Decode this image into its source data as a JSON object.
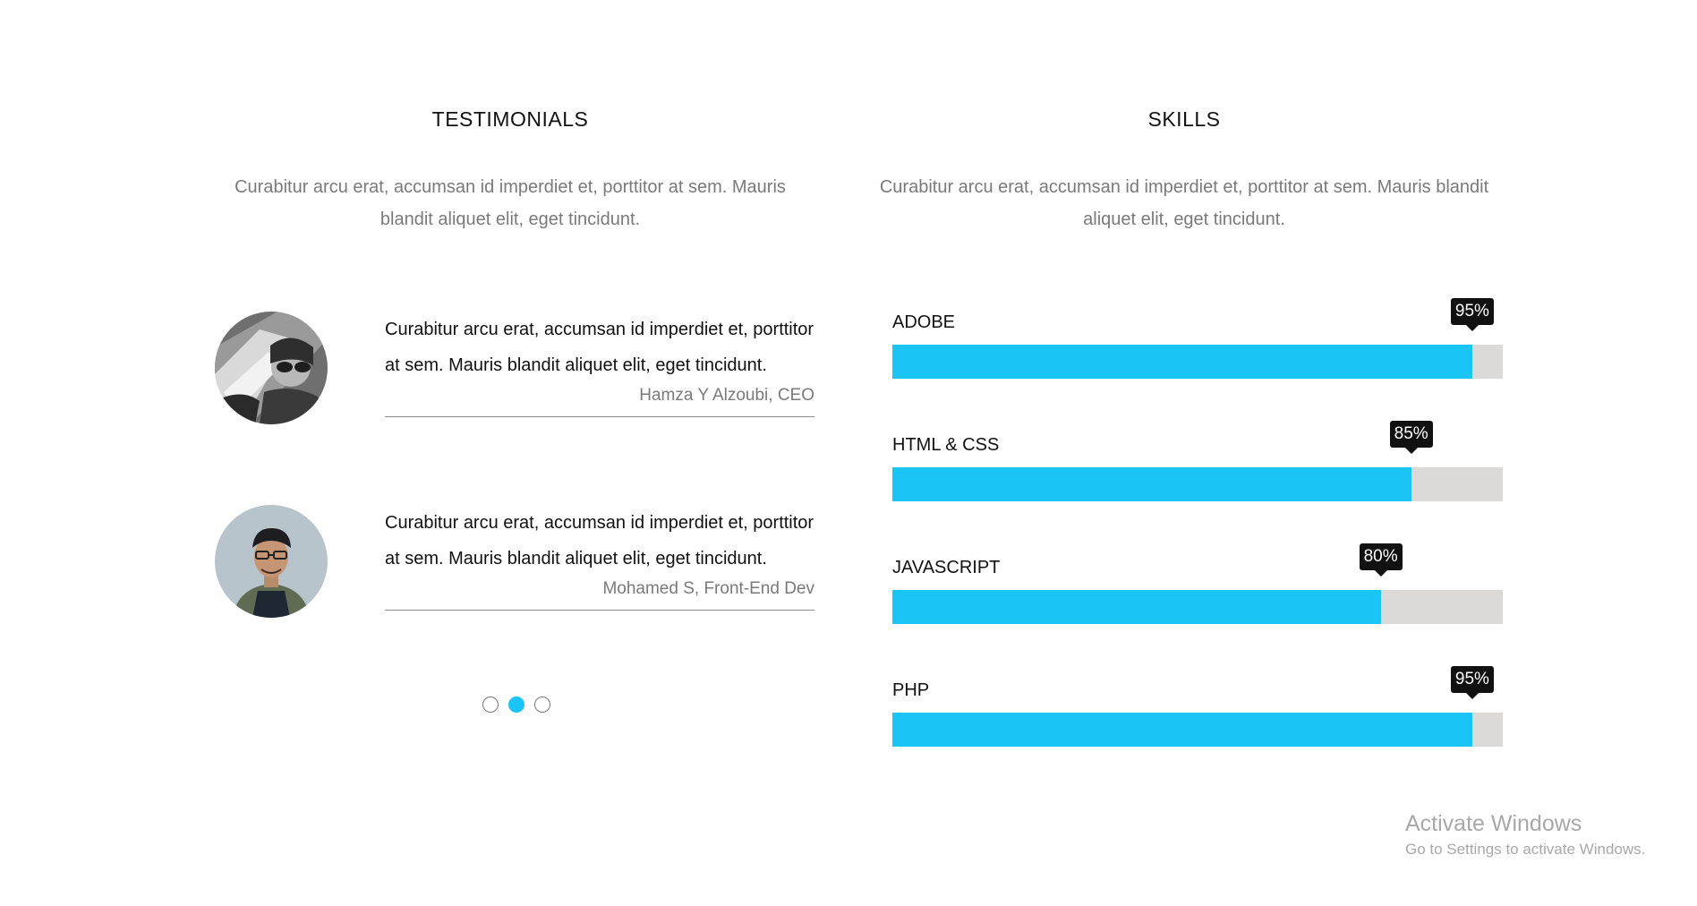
{
  "testimonials": {
    "title": "TESTIMONIALS",
    "intro": "Curabitur arcu erat, accumsan id imperdiet et, porttitor at sem. Mauris blandit aliquet elit, eget tincidunt.",
    "items": [
      {
        "quote": "Curabitur arcu erat, accumsan id imperdiet et, porttitor at sem. Mauris blandit aliquet elit, eget tincidunt.",
        "author": "Hamza Y Alzoubi, CEO"
      },
      {
        "quote": "Curabitur arcu erat, accumsan id imperdiet et, porttitor at sem. Mauris blandit aliquet elit, eget tincidunt.",
        "author": "Mohamed S, Front-End Dev"
      }
    ],
    "pagination": {
      "count": 3,
      "active_index": 1
    }
  },
  "skills": {
    "title": "SKILLS",
    "intro": "Curabitur arcu erat, accumsan id imperdiet et, porttitor at sem. Mauris blandit aliquet elit, eget tincidunt.",
    "items": [
      {
        "label": "ADOBE",
        "percent": 95,
        "percent_label": "95%"
      },
      {
        "label": "HTML & CSS",
        "percent": 85,
        "percent_label": "85%"
      },
      {
        "label": "JAVASCRIPT",
        "percent": 80,
        "percent_label": "80%"
      },
      {
        "label": "PHP",
        "percent": 95,
        "percent_label": "95%"
      }
    ]
  },
  "watermark": {
    "title": "Activate Windows",
    "subtitle": "Go to Settings to activate Windows."
  },
  "colors": {
    "accent": "#1ac5f6",
    "track": "#dcd9d9",
    "badge": "#111111",
    "muted_text": "#7a7a7a"
  }
}
